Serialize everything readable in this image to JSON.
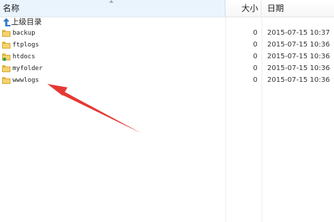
{
  "header": {
    "name_label": "名称",
    "size_label": "大小",
    "date_label": "日期"
  },
  "up_row": {
    "label": "上级目录"
  },
  "files": [
    {
      "name": "backup",
      "size": "0",
      "date": "2015-07-15 10:37",
      "icon": "folder-icon"
    },
    {
      "name": "ftplogs",
      "size": "0",
      "date": "2015-07-15 10:36",
      "icon": "folder-icon"
    },
    {
      "name": "htdocs",
      "size": "0",
      "date": "2015-07-15 10:36",
      "icon": "folder-web-icon"
    },
    {
      "name": "myfolder",
      "size": "0",
      "date": "2015-07-15 10:36",
      "icon": "folder-icon"
    },
    {
      "name": "wwwlogs",
      "size": "0",
      "date": "2015-07-15 10:36",
      "icon": "folder-icon"
    }
  ],
  "colors": {
    "arrow": "#e53935",
    "selected_header": "#eaf4fd",
    "folder": "#f5d36d"
  }
}
